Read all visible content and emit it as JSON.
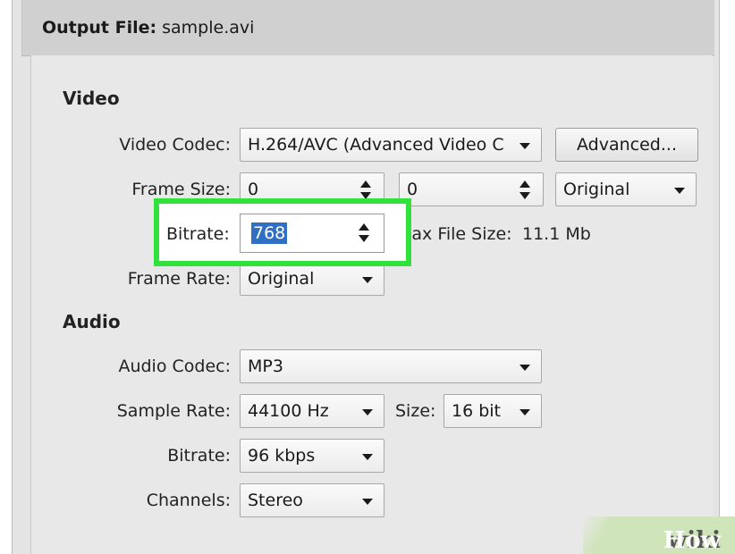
{
  "header": {
    "prefix": "Output File:",
    "filename": "sample.avi"
  },
  "video": {
    "section_title": "Video",
    "codec_label": "Video Codec:",
    "codec_value": "H.264/AVC (Advanced Video C",
    "advanced_label": "Advanced...",
    "frame_size_label": "Frame Size:",
    "width_value": "0",
    "height_value": "0",
    "size_preset": "Original",
    "bitrate_label": "Bitrate:",
    "bitrate_value": "768",
    "max_file_size_label": "Max File Size:",
    "max_file_size_value": "11.1 Mb",
    "frame_rate_label": "Frame Rate:",
    "frame_rate_value": "Original"
  },
  "audio": {
    "section_title": "Audio",
    "codec_label": "Audio Codec:",
    "codec_value": "MP3",
    "sample_rate_label": "Sample Rate:",
    "sample_rate_value": "44100 Hz",
    "size_label": "Size:",
    "size_value": "16 bit",
    "bitrate_label": "Bitrate:",
    "bitrate_value": "96 kbps",
    "channels_label": "Channels:",
    "channels_value": "Stereo"
  },
  "watermark": {
    "wiki": "wiki",
    "how": "How"
  },
  "colors": {
    "highlight": "#31e23c",
    "selection": "#2f6fc4",
    "panel": "#e8e8e8"
  }
}
